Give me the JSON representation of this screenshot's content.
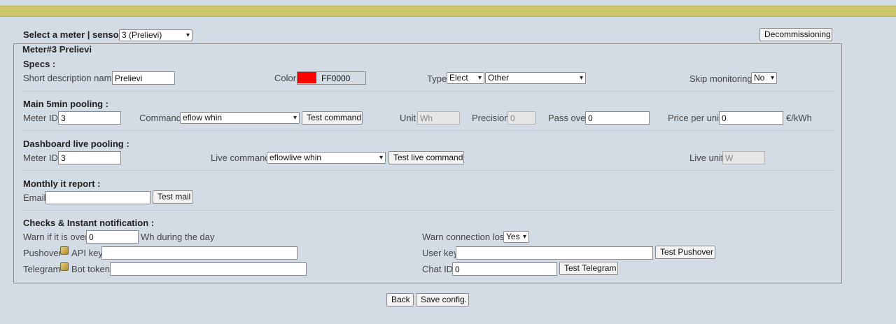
{
  "header": {
    "select_label": "Select a meter | sensor :",
    "meter_select": "3 (Prelievi)",
    "decommission_label": "Decommissioning"
  },
  "meter": {
    "legend": "Meter#3 Prelievi",
    "specs": {
      "title": "Specs :",
      "short_desc_label": "Short description name",
      "short_desc_value": "Prelievi",
      "color_label": "Color",
      "color_value": "FF0000",
      "color_hex": "#FF0000",
      "type_label": "Type",
      "type_value": "Elect",
      "subtype_value": "Other",
      "skip_label": "Skip monitoring",
      "skip_value": "No"
    },
    "main": {
      "title": "Main 5min pooling :",
      "meter_id_label": "Meter ID",
      "meter_id_value": "3",
      "command_label": "Command",
      "command_value": "eflow whin",
      "test_command_label": "Test command",
      "unit_label": "Unit",
      "unit_value": "Wh",
      "precision_label": "Precision",
      "precision_value": "0",
      "pass_over_label": "Pass over",
      "pass_over_value": "0",
      "price_label": "Price per unit",
      "price_value": "0",
      "price_unit": "€/kWh"
    },
    "live": {
      "title": "Dashboard live pooling :",
      "meter_id_label": "Meter ID",
      "meter_id_value": "3",
      "command_label": "Live command",
      "command_value": "eflowlive whin",
      "test_label": "Test live command",
      "unit_label": "Live unit",
      "unit_value": "W"
    },
    "monthly": {
      "title": "Monthly it report :",
      "email_label": "Email",
      "email_value": "",
      "test_label": "Test mail"
    },
    "checks": {
      "title": "Checks & Instant notification :",
      "warn_label": "Warn if it is over",
      "warn_value": "0",
      "warn_suffix": "Wh during the day",
      "conn_label": "Warn connection lost",
      "conn_value": "Yes",
      "pushover_label": "Pushover",
      "api_key_label": "API key",
      "api_key_value": "",
      "user_key_label": "User key",
      "user_key_value": "",
      "test_pushover_label": "Test Pushover",
      "telegram_label": "Telegram",
      "bot_token_label": "Bot token",
      "bot_token_value": "",
      "chat_id_label": "Chat ID",
      "chat_id_value": "0",
      "test_telegram_label": "Test Telegram"
    }
  },
  "footer": {
    "back_label": "Back",
    "save_label": "Save config."
  },
  "icons": {
    "chevron": "▾",
    "pushover_icon": "pushover-icon",
    "telegram_icon": "telegram-icon"
  },
  "colors": {
    "topbar": "#cdc56a",
    "background": "#d3dbe5"
  }
}
